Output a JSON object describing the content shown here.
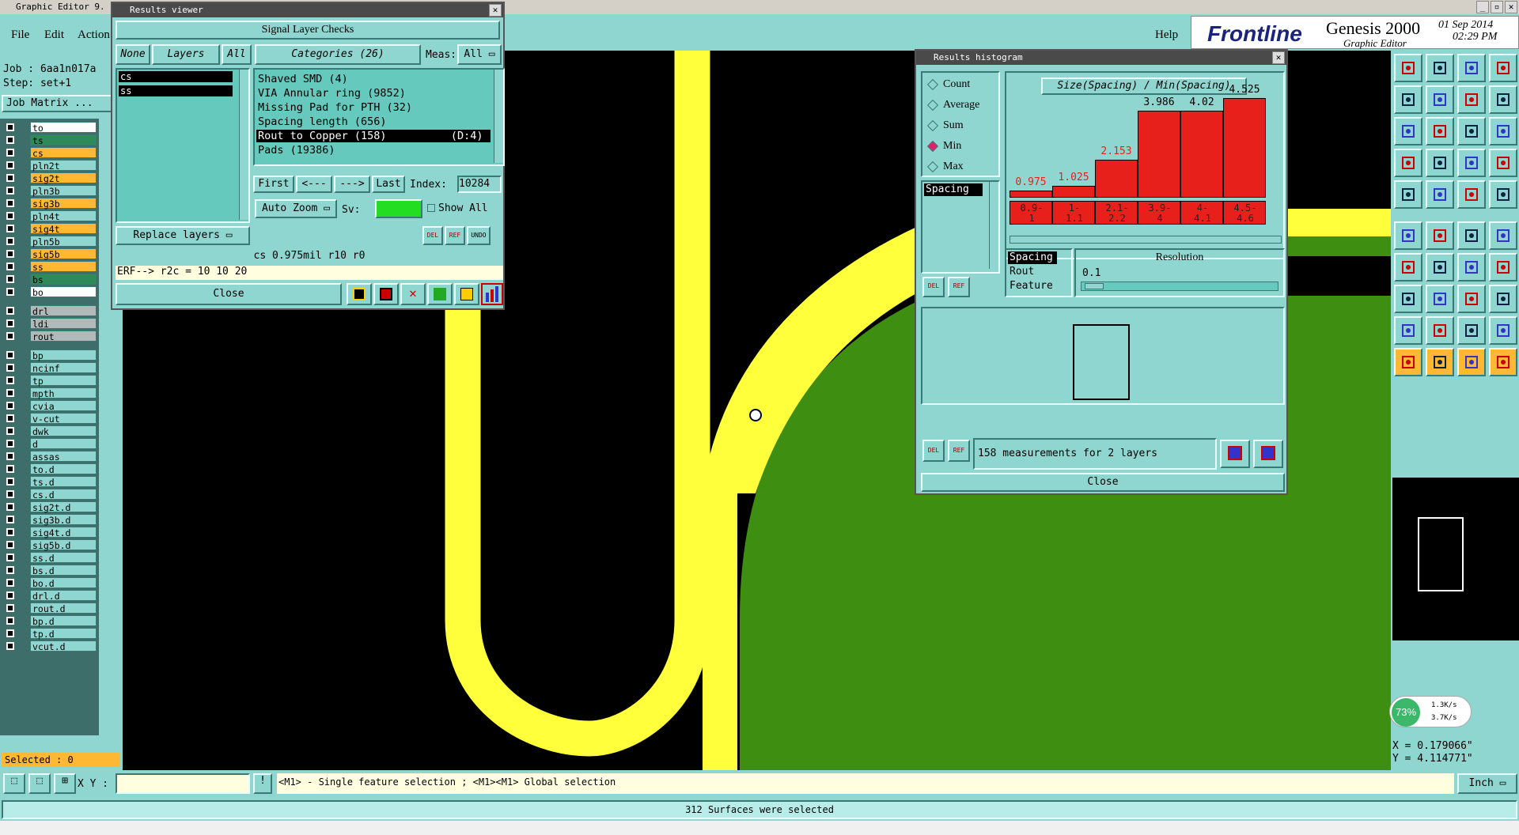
{
  "app": {
    "title": "Graphic Editor 9.",
    "window_buttons": [
      "_",
      "▫",
      "✕"
    ]
  },
  "menu": {
    "file": "File",
    "edit": "Edit",
    "action": "Action",
    "help": "Help"
  },
  "brand": {
    "logo": "Frontline",
    "product": "Genesis 2000",
    "subtitle": "Graphic Editor",
    "date": "01 Sep 2014",
    "time": "02:29 PM"
  },
  "job": {
    "job_label": "Job : 6aa1n017a",
    "step_label": "Step: set+1",
    "matrix_label": "Job Matrix ..."
  },
  "layers": [
    {
      "name": "to",
      "color": "#ffffff"
    },
    {
      "name": "ts",
      "color": "#2e8b57"
    },
    {
      "name": "cs",
      "color": "#ffb833"
    },
    {
      "name": "pln2t",
      "color": "#8fd6d0"
    },
    {
      "name": "sig2t",
      "color": "#ffb833"
    },
    {
      "name": "pln3b",
      "color": "#8fd6d0"
    },
    {
      "name": "sig3b",
      "color": "#ffb833"
    },
    {
      "name": "pln4t",
      "color": "#8fd6d0"
    },
    {
      "name": "sig4t",
      "color": "#ffb833"
    },
    {
      "name": "pln5b",
      "color": "#8fd6d0"
    },
    {
      "name": "sig5b",
      "color": "#ffb833"
    },
    {
      "name": "ss",
      "color": "#ffb833"
    },
    {
      "name": "bs",
      "color": "#2e8b57"
    },
    {
      "name": "bo",
      "color": "#ffffff"
    },
    {
      "name": "drl",
      "color": "#b0b8b8"
    },
    {
      "name": "ldi",
      "color": "#b0b8b8"
    },
    {
      "name": "rout",
      "color": "#b0b8b8"
    },
    {
      "name": "bp",
      "color": "#8fd6d0"
    },
    {
      "name": "ncinf",
      "color": "#8fd6d0"
    },
    {
      "name": "tp",
      "color": "#8fd6d0"
    },
    {
      "name": "mpth",
      "color": "#8fd6d0"
    },
    {
      "name": "cvia",
      "color": "#8fd6d0"
    },
    {
      "name": "v-cut",
      "color": "#8fd6d0"
    },
    {
      "name": "dwk",
      "color": "#8fd6d0"
    },
    {
      "name": "d",
      "color": "#8fd6d0"
    },
    {
      "name": "assas",
      "color": "#8fd6d0"
    },
    {
      "name": "to.d",
      "color": "#8fd6d0"
    },
    {
      "name": "ts.d",
      "color": "#8fd6d0"
    },
    {
      "name": "cs.d",
      "color": "#8fd6d0"
    },
    {
      "name": "sig2t.d",
      "color": "#8fd6d0"
    },
    {
      "name": "sig3b.d",
      "color": "#8fd6d0"
    },
    {
      "name": "sig4t.d",
      "color": "#8fd6d0"
    },
    {
      "name": "sig5b.d",
      "color": "#8fd6d0"
    },
    {
      "name": "ss.d",
      "color": "#8fd6d0"
    },
    {
      "name": "bs.d",
      "color": "#8fd6d0"
    },
    {
      "name": "bo.d",
      "color": "#8fd6d0"
    },
    {
      "name": "drl.d",
      "color": "#8fd6d0"
    },
    {
      "name": "rout.d",
      "color": "#8fd6d0"
    },
    {
      "name": "bp.d",
      "color": "#8fd6d0"
    },
    {
      "name": "tp.d",
      "color": "#8fd6d0"
    },
    {
      "name": "vcut.d",
      "color": "#8fd6d0"
    }
  ],
  "selected_label": "Selected : 0",
  "results_viewer": {
    "title": "Results viewer",
    "header": "Signal Layer Checks",
    "none": "None",
    "layers": "Layers",
    "all": "All",
    "categories": "Categories (26)",
    "meas_label": "Meas:",
    "meas_value": "All",
    "layer_items": [
      "cs",
      "ss"
    ],
    "category_items": [
      "Shaved SMD (4)",
      "VIA Annular ring (9852)",
      "Missing Pad for PTH (32)",
      "Spacing length (656)",
      "Rout to Copper (158)          (D:4)",
      "Pads (19386)"
    ],
    "nav": {
      "first": "First",
      "prev": "<---",
      "next": "--->",
      "last": "Last",
      "index_label": "Index:",
      "index_value": "10284"
    },
    "auto_zoom": "Auto Zoom",
    "sv_label": "Sv:",
    "show_all": "Show  All",
    "replace_layers": "Replace layers",
    "icons": {
      "del": "DEL",
      "ref": "REF",
      "undo": "UNDO"
    },
    "measure": "cs 0.975mil   r10   r0",
    "erf": "ERF--> r2c = 10 10 20",
    "close": "Close"
  },
  "histogram": {
    "title": "Results histogram",
    "mode_title": "Size(Spacing) / Min(Spacing)",
    "modes": [
      "Count",
      "Average",
      "Sum",
      "Min",
      "Max"
    ],
    "selected_mode": "Min",
    "list_top": [
      "Spacing"
    ],
    "bars": [
      {
        "value": "0.975",
        "label_top": "0.9-",
        "label_bot": "1",
        "height": 0.06,
        "red": true
      },
      {
        "value": "1.025",
        "label_top": "1-",
        "label_bot": "1.1",
        "height": 0.1,
        "red": true
      },
      {
        "value": "2.153",
        "label_top": "2.1-",
        "label_bot": "2.2",
        "height": 0.32,
        "red": true
      },
      {
        "value": "3.986",
        "label_top": "3.9-",
        "label_bot": "4",
        "height": 0.73,
        "red": false
      },
      {
        "value": "4.02",
        "label_top": "4-",
        "label_bot": "4.1",
        "height": 0.73,
        "red": false
      },
      {
        "value": "4.525",
        "label_top": "4.5-",
        "label_bot": "4.6",
        "height": 0.84,
        "red": false
      }
    ],
    "list_bottom": [
      "Spacing",
      "Rout",
      "Feature"
    ],
    "resolution_label": "Resolution",
    "resolution_value": "0.1",
    "measurements": "158 measurements for 2 layers",
    "close": "Close"
  },
  "status": {
    "xy_label": "X Y :",
    "hint": "<M1> - Single feature selection ; <M1><M1> Global selection",
    "unit": "Inch",
    "message": "312 Surfaces were selected"
  },
  "coords": {
    "x": "X = 0.179066\"",
    "y": "Y = 4.114771\""
  },
  "net": {
    "percent": "73%",
    "up": "1.3K/s",
    "down": "3.7K/s"
  }
}
